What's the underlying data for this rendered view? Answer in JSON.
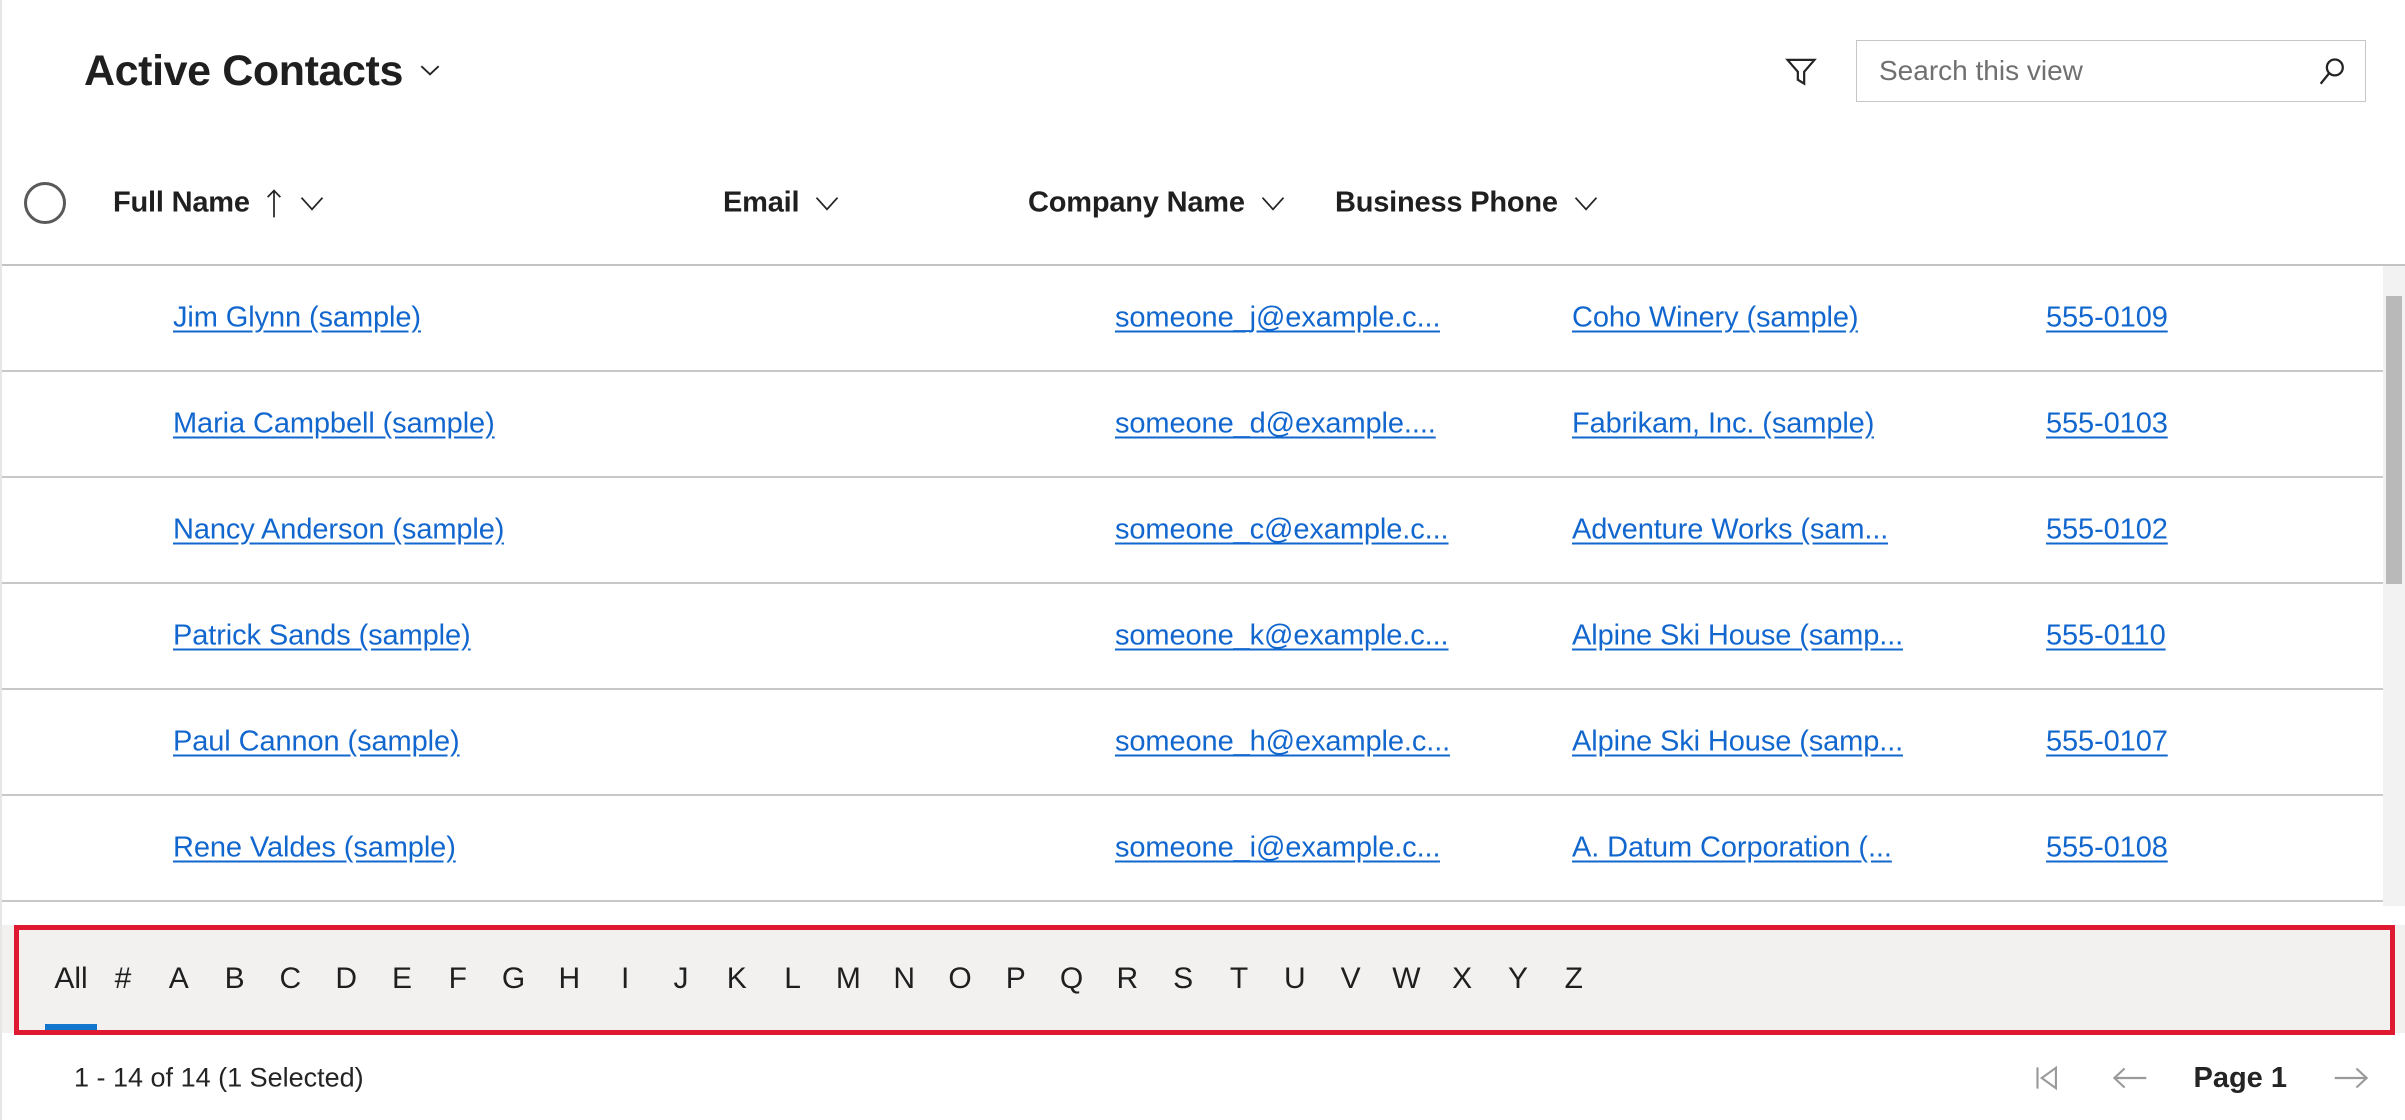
{
  "view": {
    "title": "Active Contacts",
    "dropdown_icon": "chevron-down-icon"
  },
  "toolbar": {
    "filter_icon": "filter-funnel-icon",
    "search": {
      "placeholder": "Search this view",
      "value": "",
      "icon": "search-icon"
    }
  },
  "grid": {
    "select_all_label": "",
    "columns": [
      {
        "label": "Full Name",
        "sort": "ascending",
        "sort_icon": "arrow-up-icon",
        "menu_icon": "chevron-down-icon"
      },
      {
        "label": "Email",
        "sort": "none",
        "menu_icon": "chevron-down-icon"
      },
      {
        "label": "Company Name",
        "sort": "none",
        "menu_icon": "chevron-down-icon"
      },
      {
        "label": "Business Phone",
        "sort": "none",
        "menu_icon": "chevron-down-icon"
      }
    ],
    "rows": [
      {
        "full_name": "Jim Glynn (sample)",
        "email": "someone_j@example.c...",
        "company": "Coho Winery (sample)",
        "phone": "555-0109"
      },
      {
        "full_name": "Maria Campbell (sample)",
        "email": "someone_d@example....",
        "company": "Fabrikam, Inc. (sample)",
        "phone": "555-0103"
      },
      {
        "full_name": "Nancy Anderson (sample)",
        "email": "someone_c@example.c...",
        "company": "Adventure Works (sam...",
        "phone": "555-0102"
      },
      {
        "full_name": "Patrick Sands (sample)",
        "email": "someone_k@example.c...",
        "company": "Alpine Ski House (samp...",
        "phone": "555-0110"
      },
      {
        "full_name": "Paul Cannon (sample)",
        "email": "someone_h@example.c...",
        "company": "Alpine Ski House (samp...",
        "phone": "555-0107"
      },
      {
        "full_name": "Rene Valdes (sample)",
        "email": "someone_i@example.c...",
        "company": "A. Datum Corporation (...",
        "phone": "555-0108"
      }
    ]
  },
  "alphabet_filter": {
    "items": [
      "All",
      "#",
      "A",
      "B",
      "C",
      "D",
      "E",
      "F",
      "G",
      "H",
      "I",
      "J",
      "K",
      "L",
      "M",
      "N",
      "O",
      "P",
      "Q",
      "R",
      "S",
      "T",
      "U",
      "V",
      "W",
      "X",
      "Y",
      "Z"
    ],
    "selected": "All",
    "annotation_color": "#e01933",
    "selected_indicator_color": "#1277cc"
  },
  "footer": {
    "record_count": "1 - 14 of 14 (1 Selected)",
    "page_label": "Page 1",
    "first_page_icon": "first-page-icon",
    "prev_page_icon": "previous-page-icon",
    "next_page_icon": "next-page-icon"
  },
  "colors": {
    "link": "#1267cf",
    "accent": "#1277cc",
    "annotation": "#e01933",
    "text": "#1f1f1f",
    "row_border": "#c8c8c8",
    "alpha_bar_bg": "#f2f1f0"
  }
}
